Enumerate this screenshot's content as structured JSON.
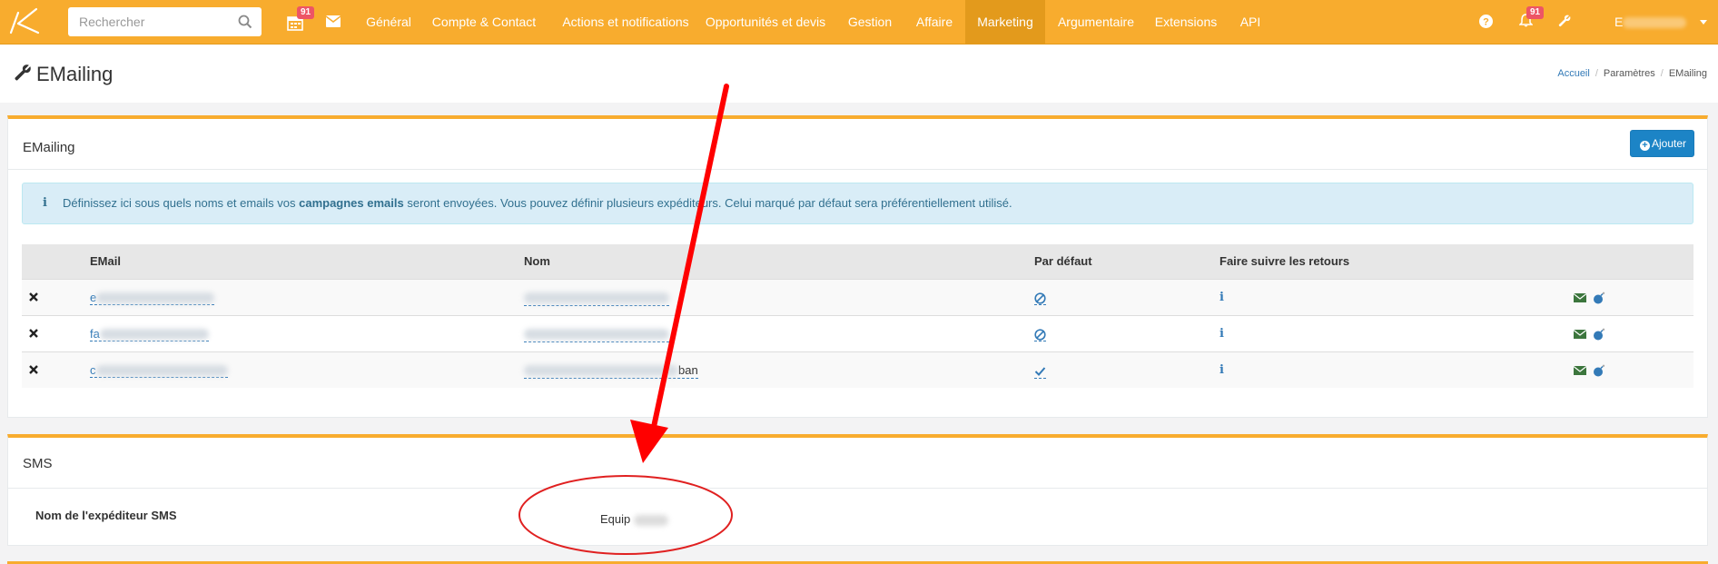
{
  "topnav": {
    "search_placeholder": "Rechercher",
    "calendar_badge": "91",
    "bell_badge": "91",
    "items": [
      {
        "label": "Général"
      },
      {
        "label": "Compte & Contact"
      },
      {
        "label": "Actions et notifications"
      },
      {
        "label": "Opportunités et devis"
      },
      {
        "label": "Gestion"
      },
      {
        "label": "Affaire"
      },
      {
        "label": "Marketing"
      },
      {
        "label": "Argumentaire"
      },
      {
        "label": "Extensions"
      },
      {
        "label": "API"
      }
    ],
    "active_item": "Marketing",
    "user_initial": "E",
    "accent_color": "#f8ac2e"
  },
  "page": {
    "title": "EMailing",
    "breadcrumb": [
      "Accueil",
      "Paramètres",
      "EMailing"
    ]
  },
  "emailing_panel": {
    "title": "EMailing",
    "add_button": "Ajouter",
    "info_prefix": "Définissez ici sous quels noms et emails vos ",
    "info_bold": "campagnes emails",
    "info_suffix": " seront envoyées. Vous pouvez définir plusieurs expéditeurs. Celui marqué par défaut sera préférentiellement utilisé.",
    "columns": [
      "EMail",
      "Nom",
      "Par défaut",
      "Faire suivre les retours"
    ],
    "rows": [
      {
        "email_start": "e",
        "name_end": "",
        "default": "ban-icon",
        "forward": "i"
      },
      {
        "email_start": "fa",
        "name_end": "",
        "default": "ban-icon",
        "forward": "i"
      },
      {
        "email_start": "c",
        "name_end": "ban",
        "default": "check-icon",
        "forward": "i"
      }
    ]
  },
  "sms_panel": {
    "title": "SMS",
    "sender_label": "Nom de l'expéditeur SMS",
    "sender_value": "Equip"
  },
  "annotation": {
    "arrow_color": "#ff0000",
    "ellipse_color": "#e02020"
  }
}
